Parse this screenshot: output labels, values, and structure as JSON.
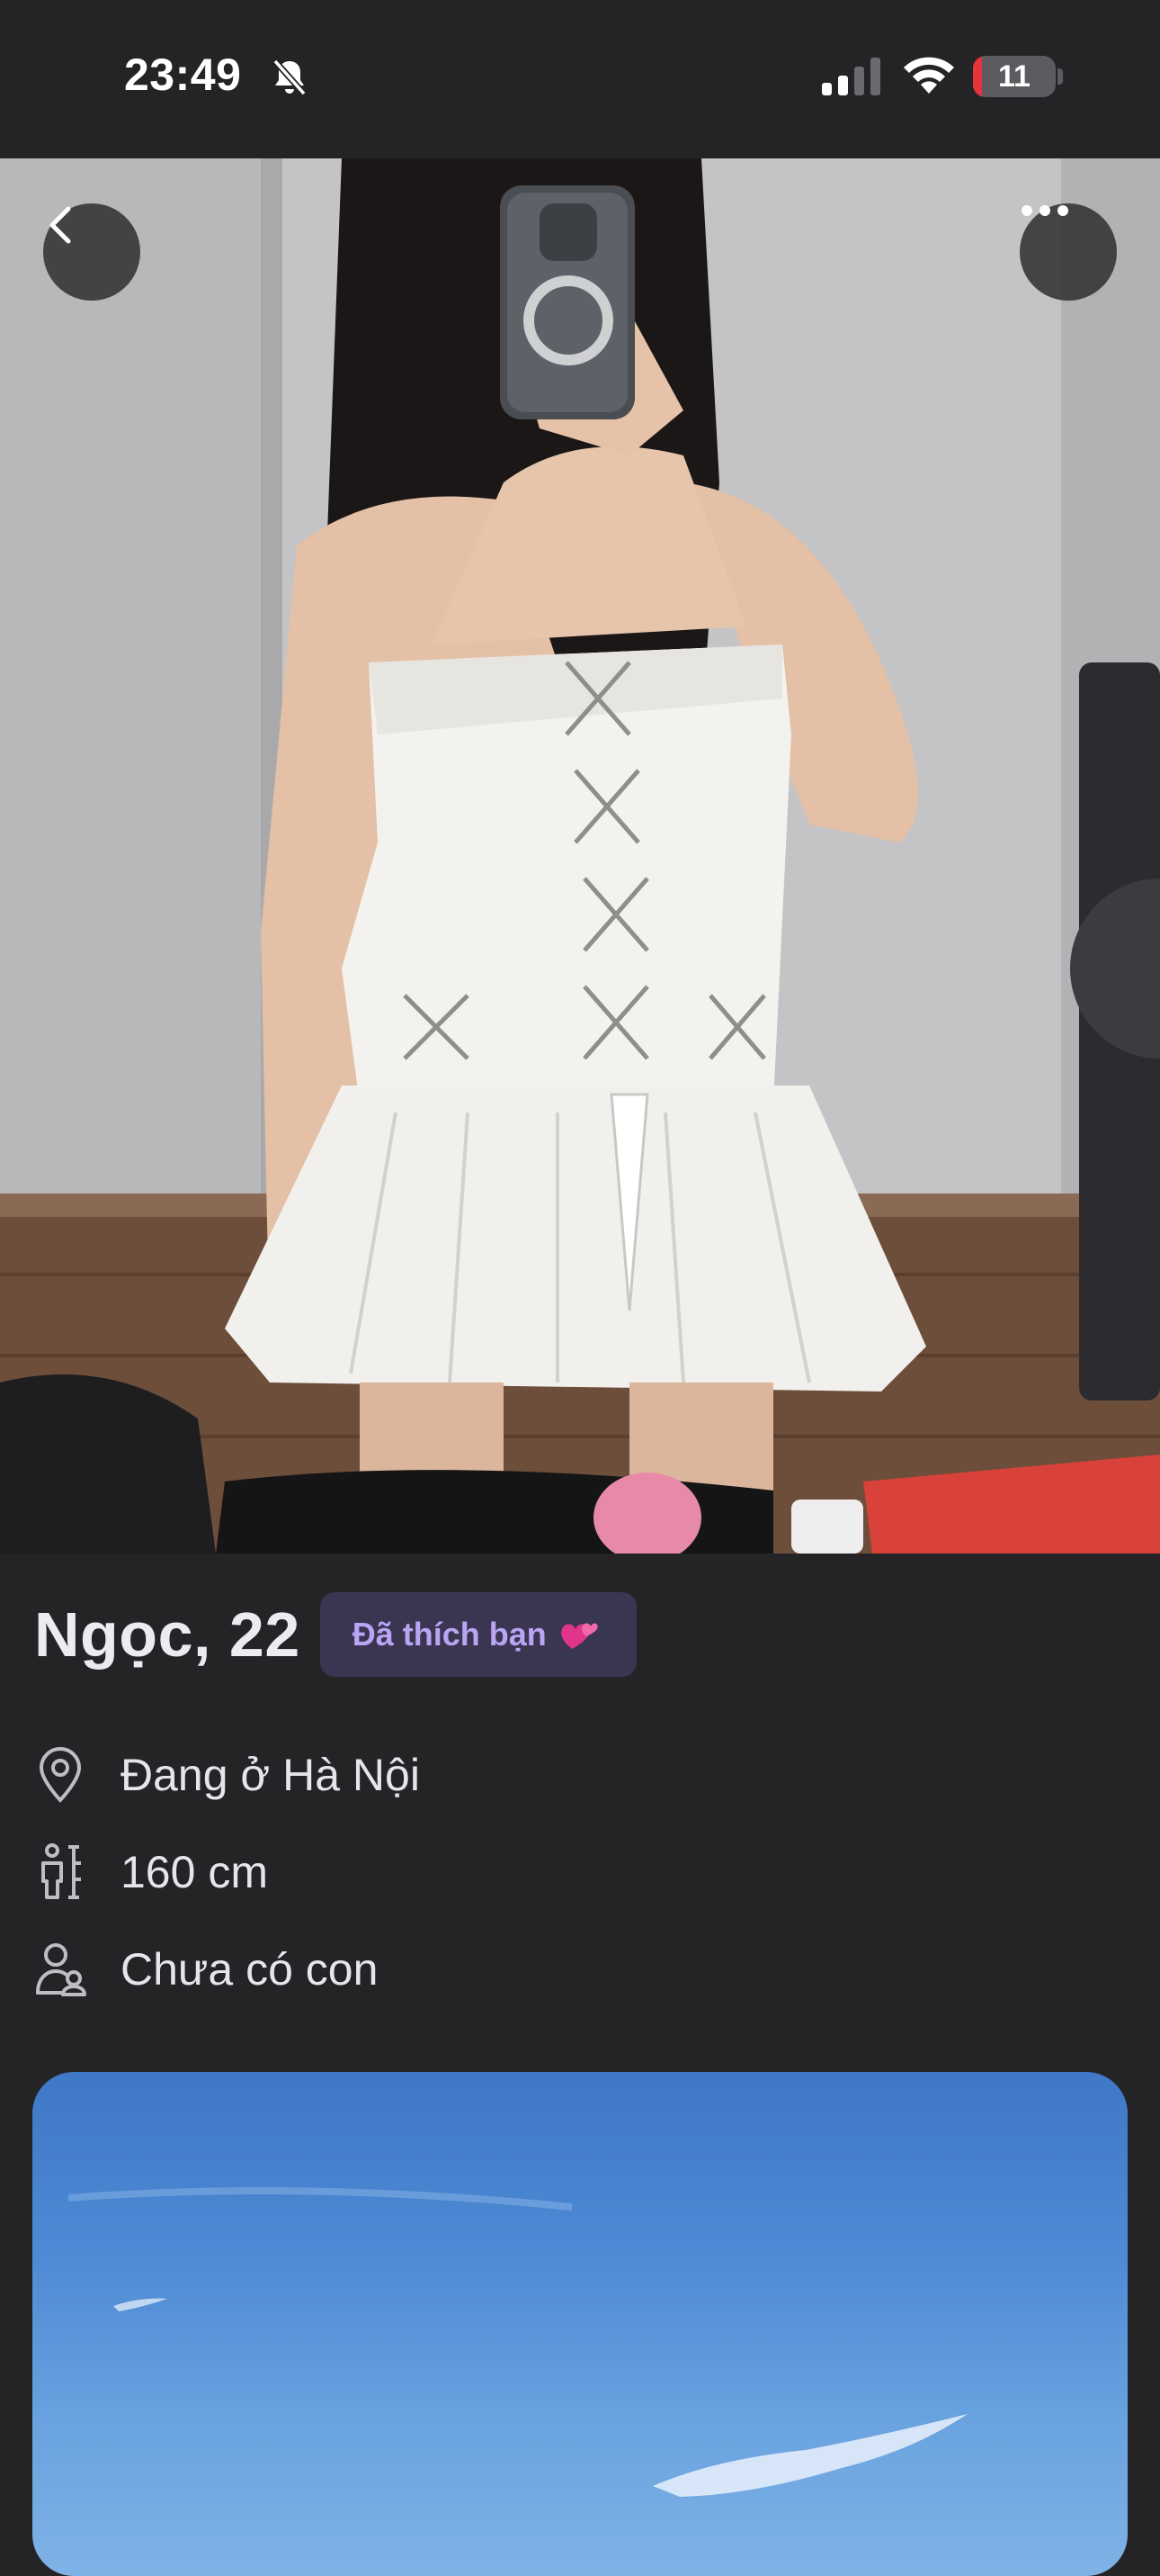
{
  "status_bar": {
    "time": "23:49",
    "battery_level": "11",
    "battery_fraction": 0.11,
    "icons": [
      "bell-slash-icon",
      "signal-icon",
      "wifi-icon",
      "battery-icon"
    ]
  },
  "hero": {
    "back_icon": "chevron-left-icon",
    "more_icon": "ellipsis-icon"
  },
  "profile": {
    "name_age": "Ngọc, 22",
    "liked_badge": "Đã thích bạn",
    "liked_badge_icon": "two-hearts-icon",
    "details": [
      {
        "icon": "location-pin-icon",
        "text": "Đang ở Hà Nội"
      },
      {
        "icon": "height-icon",
        "text": "160 cm"
      },
      {
        "icon": "children-icon",
        "text": "Chưa có con"
      }
    ]
  },
  "colors": {
    "background": "#242427",
    "badge_background": "#3a3550",
    "badge_text": "#b9a5f4",
    "battery_low": "#e5343b"
  }
}
